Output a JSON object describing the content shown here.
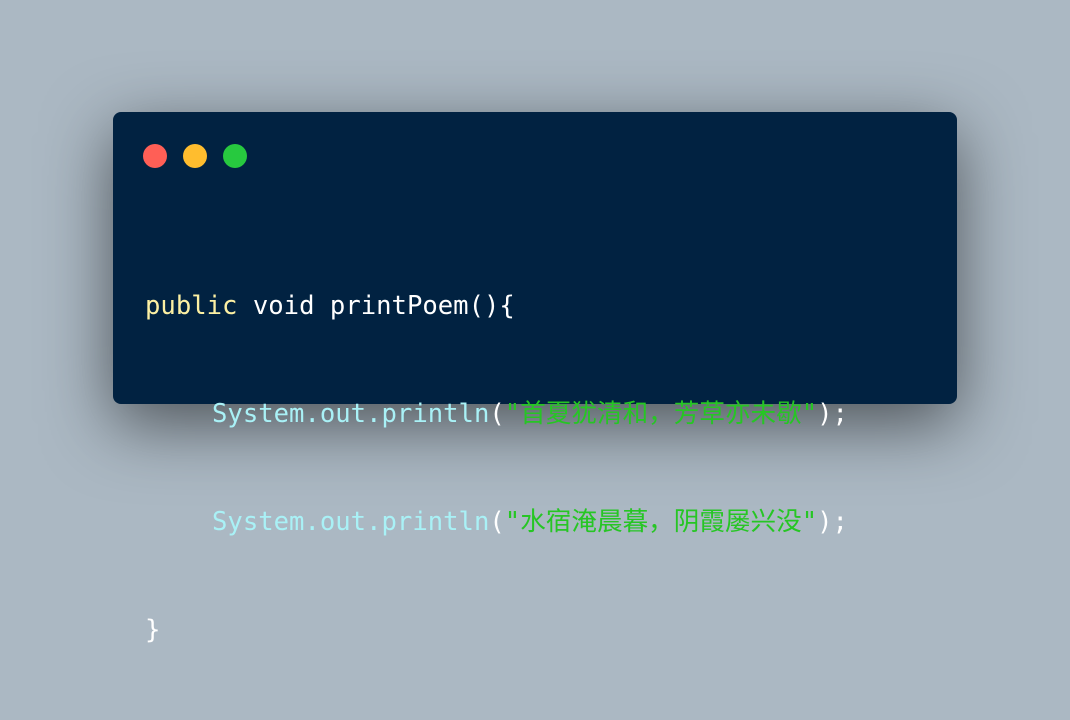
{
  "colors": {
    "background": "#abb8c3",
    "window": "#012241",
    "close": "#ff5f56",
    "minimize": "#ffbd2e",
    "maximize": "#27c93f",
    "keyword": "#fcf0a3",
    "plain": "#ffffff",
    "class": "#a9f1f6",
    "string": "#26c624"
  },
  "window_controls": [
    "close-icon",
    "minimize-icon",
    "maximize-icon"
  ],
  "code": {
    "line1": {
      "keyword": "public",
      "text": " void printPoem(){"
    },
    "line2": {
      "object": "System.out.println",
      "open": "(",
      "string": "\"首夏犹清和，芳草亦未歇\"",
      "close": ");"
    },
    "line3": {
      "object": "System.out.println",
      "open": "(",
      "string": "\"水宿淹晨暮，阴霞屡兴没\"",
      "close": ");"
    },
    "line4": {
      "text": "}"
    }
  }
}
